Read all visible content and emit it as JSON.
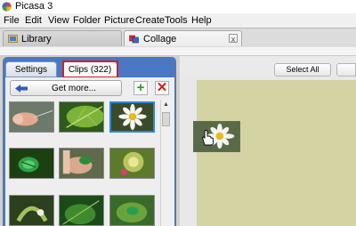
{
  "window": {
    "title": "Picasa 3"
  },
  "menu": [
    "File",
    "Edit",
    "View",
    "Folder",
    "Picture",
    "Create",
    "Tools",
    "Help"
  ],
  "tabs": [
    {
      "label": "Library",
      "icon": "library-icon",
      "active": false
    },
    {
      "label": "Collage",
      "icon": "collage-icon",
      "active": true,
      "close": "x"
    }
  ],
  "panel": {
    "tabs": [
      {
        "label": "Settings",
        "active": false
      },
      {
        "label": "Clips (322)",
        "active": true,
        "highlighted": true
      }
    ],
    "get_more_label": "Get more...",
    "add_label": "+",
    "remove_label": "✕",
    "thumbnails": [
      {
        "subject": "finger-with-needle",
        "selected": false
      },
      {
        "subject": "green-leaf",
        "selected": false
      },
      {
        "subject": "white-daisy",
        "selected": true
      },
      {
        "subject": "green-beetle",
        "selected": false
      },
      {
        "subject": "hand-with-insect",
        "selected": false
      },
      {
        "subject": "dandelion-seedhead",
        "selected": false
      },
      {
        "subject": "curled-leaf",
        "selected": false
      },
      {
        "subject": "green-leaf-close",
        "selected": false
      },
      {
        "subject": "green-beetle-on-leaf",
        "selected": false
      }
    ]
  },
  "collage": {
    "select_all_label": "Select All",
    "dragged_clip": "white-daisy"
  },
  "colors": {
    "panel_blue": "#4a78c4",
    "highlight_red": "#d42020",
    "canvas_olive": "#d3d3a3",
    "selection_blue": "#2f86d8"
  }
}
